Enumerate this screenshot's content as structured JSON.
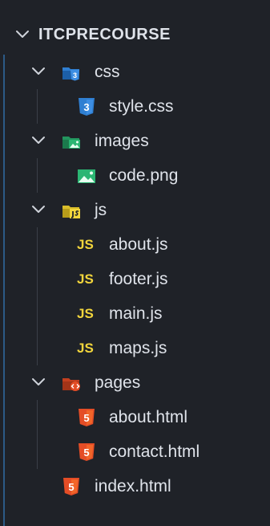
{
  "explorer": {
    "root": {
      "label": "ITCPRECOURSE",
      "icon": "chevron-down-icon"
    },
    "items": [
      {
        "label": "css",
        "type": "folder",
        "icon": "css-folder-icon",
        "expanded": true
      },
      {
        "label": "style.css",
        "type": "file",
        "icon": "css-file-icon"
      },
      {
        "label": "images",
        "type": "folder",
        "icon": "images-folder-icon",
        "expanded": true
      },
      {
        "label": "code.png",
        "type": "file",
        "icon": "image-file-icon"
      },
      {
        "label": "js",
        "type": "folder",
        "icon": "js-folder-icon",
        "expanded": true
      },
      {
        "label": "about.js",
        "type": "file",
        "icon": "js-file-icon",
        "badge": "JS"
      },
      {
        "label": "footer.js",
        "type": "file",
        "icon": "js-file-icon",
        "badge": "JS"
      },
      {
        "label": "main.js",
        "type": "file",
        "icon": "js-file-icon",
        "badge": "JS"
      },
      {
        "label": "maps.js",
        "type": "file",
        "icon": "js-file-icon",
        "badge": "JS"
      },
      {
        "label": "pages",
        "type": "folder",
        "icon": "html-folder-icon",
        "expanded": true
      },
      {
        "label": "about.html",
        "type": "file",
        "icon": "html-file-icon"
      },
      {
        "label": "contact.html",
        "type": "file",
        "icon": "html-file-icon"
      },
      {
        "label": "index.html",
        "type": "file",
        "icon": "html-file-icon"
      }
    ]
  },
  "colors": {
    "background": "#1f2228",
    "text": "#dfe3ea",
    "css_blue": "#2f7fd2",
    "images_green": "#2bb673",
    "js_yellow": "#f2d53c",
    "html_orange": "#e44d26",
    "guide": "#3a3f47",
    "root_guide": "#2c5a86"
  }
}
